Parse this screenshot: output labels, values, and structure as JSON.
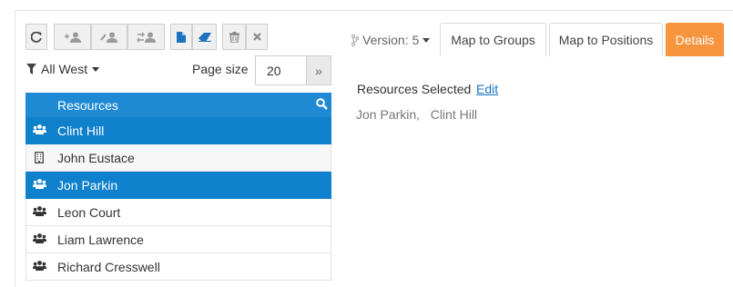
{
  "toolbar": {
    "buttons": [
      {
        "name": "refresh-button",
        "icon": "refresh-icon"
      },
      {
        "name": "add-group-button",
        "icon": "add-users-icon"
      },
      {
        "name": "edit-group-button",
        "icon": "edit-users-icon"
      },
      {
        "name": "swap-group-button",
        "icon": "swap-users-icon"
      },
      {
        "name": "document-button",
        "icon": "document-icon"
      },
      {
        "name": "eraser-button",
        "icon": "eraser-icon"
      },
      {
        "name": "delete-button",
        "icon": "trash-icon"
      },
      {
        "name": "close-button",
        "icon": "close-icon"
      }
    ]
  },
  "filter": {
    "icon": "filter-icon",
    "label": "All West"
  },
  "page_size": {
    "label": "Page size",
    "value": "20",
    "next": "»"
  },
  "resources": {
    "header": "Resources",
    "search_icon": "search-icon",
    "items": [
      {
        "label": "Clint Hill",
        "icon": "users-icon",
        "selected": true
      },
      {
        "label": "John Eustace",
        "icon": "building-icon",
        "selected": false
      },
      {
        "label": "Jon Parkin",
        "icon": "users-icon",
        "selected": true
      },
      {
        "label": "Leon Court",
        "icon": "users-icon",
        "selected": false
      },
      {
        "label": "Liam Lawrence",
        "icon": "users-icon",
        "selected": false
      },
      {
        "label": "Richard Cresswell",
        "icon": "users-icon",
        "selected": false
      }
    ]
  },
  "version": {
    "label": "Version: 5"
  },
  "tabs": [
    {
      "label": "Map to Groups",
      "active": false
    },
    {
      "label": "Map to Positions",
      "active": false
    },
    {
      "label": "Details",
      "active": true
    }
  ],
  "details": {
    "title": "Resources Selected",
    "edit": "Edit",
    "selected": "Jon Parkin,   Clint Hill"
  },
  "colors": {
    "accent": "#f7943e",
    "primary": "#1f8ad4",
    "selected_row": "#0f80cb"
  }
}
